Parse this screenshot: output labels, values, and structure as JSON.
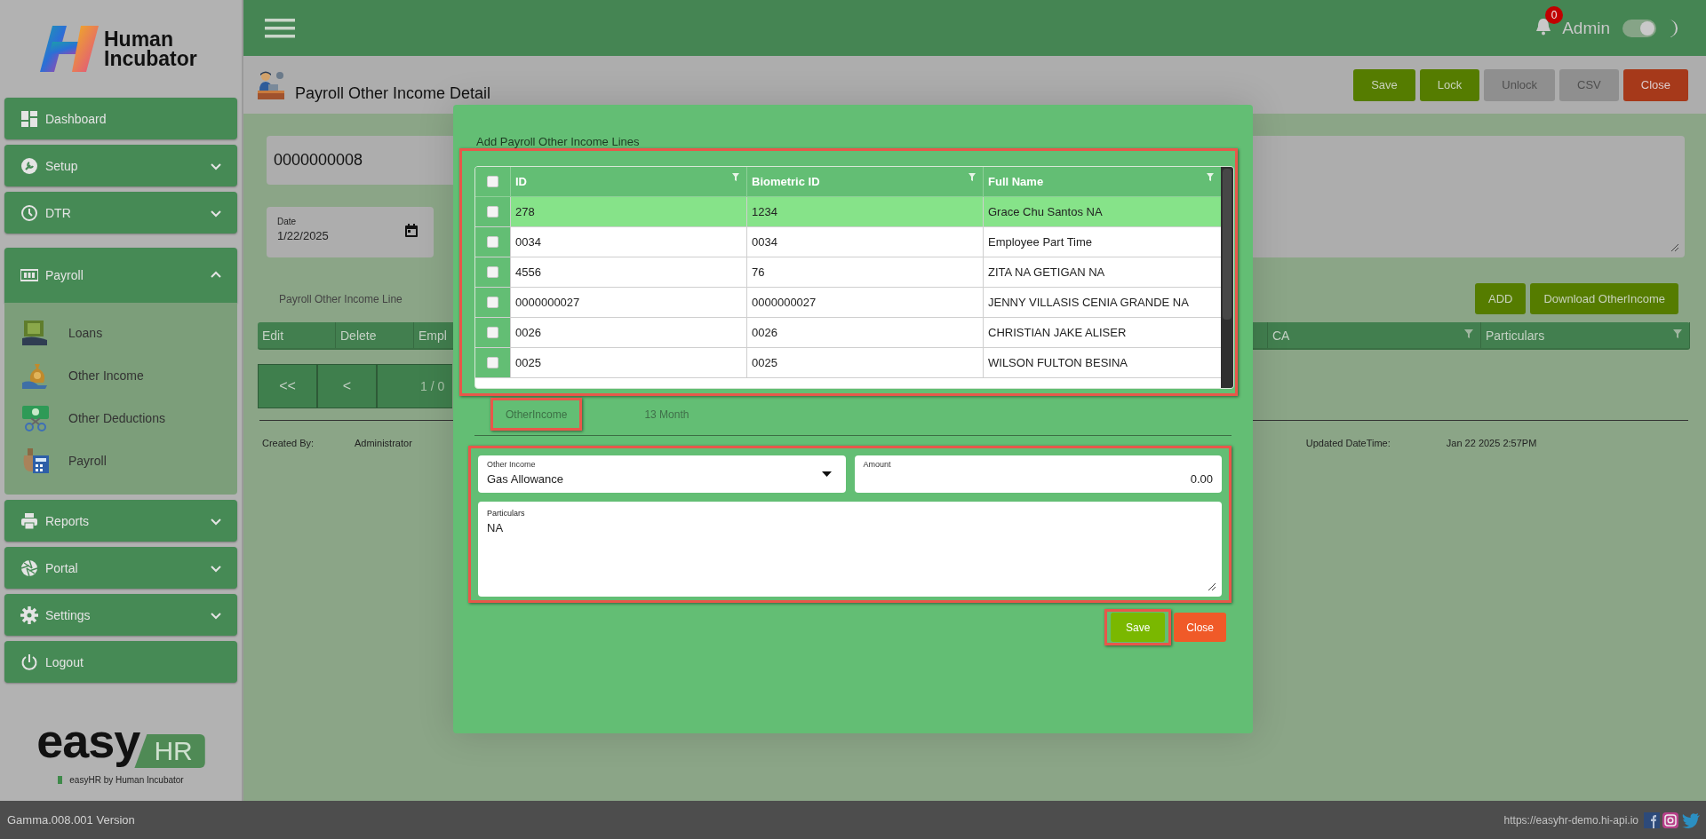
{
  "sidebar": {
    "brand": "Human Incubator",
    "items": [
      {
        "label": "Dashboard",
        "kind": "link"
      },
      {
        "label": "Setup",
        "kind": "group",
        "expanded": false
      },
      {
        "label": "DTR",
        "kind": "group",
        "expanded": false
      },
      {
        "label": "Payroll",
        "kind": "group",
        "expanded": true,
        "children": [
          {
            "label": "Loans"
          },
          {
            "label": "Other Income"
          },
          {
            "label": "Other Deductions"
          },
          {
            "label": "Payroll"
          }
        ]
      },
      {
        "label": "Reports",
        "kind": "group",
        "expanded": false
      },
      {
        "label": "Portal",
        "kind": "group",
        "expanded": false
      },
      {
        "label": "Settings",
        "kind": "group",
        "expanded": false
      },
      {
        "label": "Logout",
        "kind": "link"
      }
    ],
    "product_logo": {
      "word": "easy",
      "badge": "HR",
      "caption": "easyHR by Human Incubator"
    }
  },
  "topbar": {
    "notification_count": "0",
    "user": "Admin",
    "theme_toggle_on": true
  },
  "page": {
    "title": "Payroll Other Income Detail",
    "actions": [
      {
        "label": "Save",
        "kind": "primary"
      },
      {
        "label": "Lock",
        "kind": "primary"
      },
      {
        "label": "Unlock",
        "kind": "disabled"
      },
      {
        "label": "CSV",
        "kind": "disabled"
      },
      {
        "label": "Close",
        "kind": "danger"
      }
    ],
    "number": "0000000008",
    "date": {
      "label": "Date",
      "value": "1/22/2025"
    },
    "lines_title": "Payroll Other Income Line",
    "line_actions": [
      {
        "label": "ADD",
        "kind": "primary"
      },
      {
        "label": "Download OtherIncome",
        "kind": "primary"
      }
    ],
    "line_columns": [
      {
        "label": "Edit",
        "filter": false
      },
      {
        "label": "Delete",
        "filter": false
      },
      {
        "label": "Empl",
        "filter": false
      },
      {
        "label": "CA",
        "filter": true
      },
      {
        "label": "Particulars",
        "filter": true
      }
    ],
    "pager": {
      "first": "<<",
      "prev": "<",
      "page": "1 / 0"
    },
    "audit": [
      {
        "label": "Created By:",
        "value": "Administrator"
      },
      {
        "label": "Updated DateTime:",
        "value": "Jan 22 2025 2:57PM"
      }
    ]
  },
  "modal": {
    "title": "Add Payroll Other Income Lines",
    "grid": {
      "highlighted": true,
      "all_checked": false,
      "columns": [
        "ID",
        "Biometric ID",
        "Full Name"
      ],
      "rows": [
        {
          "id": "278",
          "biometric_id": "1234",
          "full_name": "Grace Chu Santos NA",
          "selected": true,
          "checked": false
        },
        {
          "id": "0034",
          "biometric_id": "0034",
          "full_name": "Employee Part Time",
          "selected": false,
          "checked": false
        },
        {
          "id": "4556",
          "biometric_id": "76",
          "full_name": "ZITA NA GETIGAN NA",
          "selected": false,
          "checked": false
        },
        {
          "id": "0000000027",
          "biometric_id": "0000000027",
          "full_name": "JENNY VILLASIS CENIA GRANDE NA",
          "selected": false,
          "checked": false
        },
        {
          "id": "0026",
          "biometric_id": "0026",
          "full_name": "CHRISTIAN JAKE ALISER",
          "selected": false,
          "checked": false
        },
        {
          "id": "0025",
          "biometric_id": "0025",
          "full_name": "WILSON FULTON BESINA",
          "selected": false,
          "checked": false
        }
      ]
    },
    "tabs": [
      {
        "label": "OtherIncome",
        "selected": true,
        "highlighted": true
      },
      {
        "label": "13 Month",
        "selected": false,
        "highlighted": false
      }
    ],
    "form": {
      "highlighted": true,
      "other_income": {
        "label": "Other Income",
        "value": "Gas Allowance"
      },
      "amount": {
        "label": "Amount",
        "value": "0.00"
      },
      "particulars": {
        "label": "Particulars",
        "value": "NA"
      }
    },
    "buttons": [
      {
        "label": "Save",
        "kind": "primary",
        "highlighted": true
      },
      {
        "label": "Close",
        "kind": "danger",
        "highlighted": false
      }
    ]
  },
  "status_bar": {
    "version": "Gamma.008.001 Version",
    "url": "https://easyhr-demo.hi-api.io"
  }
}
